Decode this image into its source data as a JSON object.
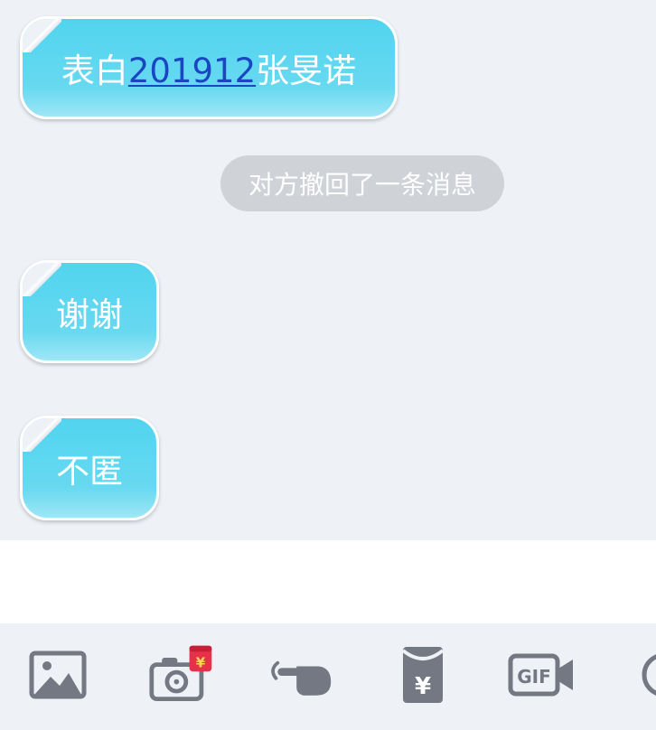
{
  "messages": [
    {
      "prefix": "表白",
      "link": "201912",
      "suffix": "张旻诺"
    },
    {
      "text": "谢谢"
    },
    {
      "text": "不匿"
    }
  ],
  "system_notice": "对方撤回了一条消息",
  "colors": {
    "bubble": "#55d5ef",
    "link": "#1b46c2",
    "chat_background": "#eef2f7",
    "notice_background": "#cfd3d8",
    "icon_gray": "#737882",
    "badge_red": "#e8304a"
  },
  "toolbar": {
    "icons": [
      "image-icon",
      "camera-icon",
      "poke-icon",
      "red-packet-icon",
      "gif-icon",
      "more-icon"
    ],
    "camera_badge": "¥",
    "red_packet_symbol": "¥",
    "gif_label": "GIF"
  }
}
